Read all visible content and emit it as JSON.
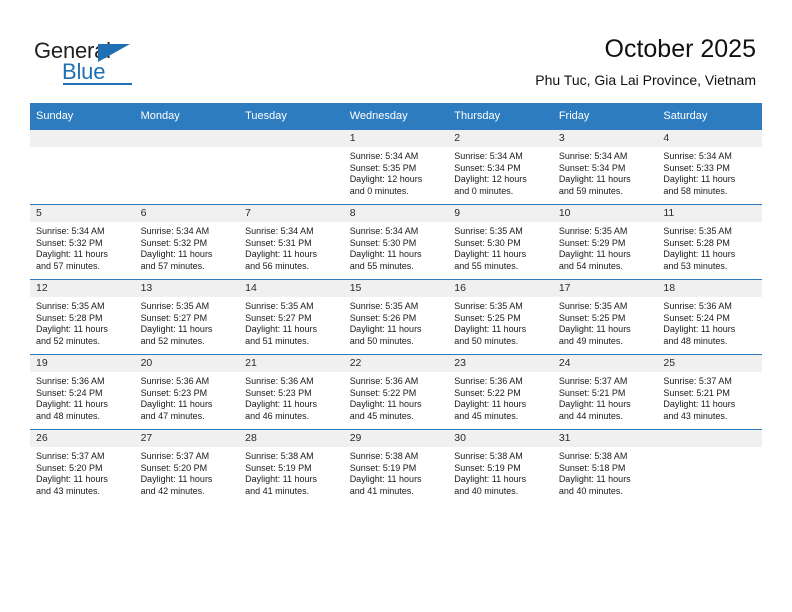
{
  "brand": {
    "name_part1": "General",
    "name_part2": "Blue",
    "accent_color": "#1f6fb4"
  },
  "header": {
    "title": "October 2025",
    "subtitle": "Phu Tuc, Gia Lai Province, Vietnam",
    "header_bg": "#2e7cc0"
  },
  "weekday_headers": [
    "Sunday",
    "Monday",
    "Tuesday",
    "Wednesday",
    "Thursday",
    "Friday",
    "Saturday"
  ],
  "weeks": [
    [
      {
        "day": "",
        "blank": true,
        "l1": "",
        "l2": "",
        "l3": "",
        "l4": ""
      },
      {
        "day": "",
        "blank": true,
        "l1": "",
        "l2": "",
        "l3": "",
        "l4": ""
      },
      {
        "day": "",
        "blank": true,
        "l1": "",
        "l2": "",
        "l3": "",
        "l4": ""
      },
      {
        "day": "1",
        "blank": false,
        "l1": "Sunrise: 5:34 AM",
        "l2": "Sunset: 5:35 PM",
        "l3": "Daylight: 12 hours",
        "l4": "and 0 minutes."
      },
      {
        "day": "2",
        "blank": false,
        "l1": "Sunrise: 5:34 AM",
        "l2": "Sunset: 5:34 PM",
        "l3": "Daylight: 12 hours",
        "l4": "and 0 minutes."
      },
      {
        "day": "3",
        "blank": false,
        "l1": "Sunrise: 5:34 AM",
        "l2": "Sunset: 5:34 PM",
        "l3": "Daylight: 11 hours",
        "l4": "and 59 minutes."
      },
      {
        "day": "4",
        "blank": false,
        "l1": "Sunrise: 5:34 AM",
        "l2": "Sunset: 5:33 PM",
        "l3": "Daylight: 11 hours",
        "l4": "and 58 minutes."
      }
    ],
    [
      {
        "day": "5",
        "blank": false,
        "l1": "Sunrise: 5:34 AM",
        "l2": "Sunset: 5:32 PM",
        "l3": "Daylight: 11 hours",
        "l4": "and 57 minutes."
      },
      {
        "day": "6",
        "blank": false,
        "l1": "Sunrise: 5:34 AM",
        "l2": "Sunset: 5:32 PM",
        "l3": "Daylight: 11 hours",
        "l4": "and 57 minutes."
      },
      {
        "day": "7",
        "blank": false,
        "l1": "Sunrise: 5:34 AM",
        "l2": "Sunset: 5:31 PM",
        "l3": "Daylight: 11 hours",
        "l4": "and 56 minutes."
      },
      {
        "day": "8",
        "blank": false,
        "l1": "Sunrise: 5:34 AM",
        "l2": "Sunset: 5:30 PM",
        "l3": "Daylight: 11 hours",
        "l4": "and 55 minutes."
      },
      {
        "day": "9",
        "blank": false,
        "l1": "Sunrise: 5:35 AM",
        "l2": "Sunset: 5:30 PM",
        "l3": "Daylight: 11 hours",
        "l4": "and 55 minutes."
      },
      {
        "day": "10",
        "blank": false,
        "l1": "Sunrise: 5:35 AM",
        "l2": "Sunset: 5:29 PM",
        "l3": "Daylight: 11 hours",
        "l4": "and 54 minutes."
      },
      {
        "day": "11",
        "blank": false,
        "l1": "Sunrise: 5:35 AM",
        "l2": "Sunset: 5:28 PM",
        "l3": "Daylight: 11 hours",
        "l4": "and 53 minutes."
      }
    ],
    [
      {
        "day": "12",
        "blank": false,
        "l1": "Sunrise: 5:35 AM",
        "l2": "Sunset: 5:28 PM",
        "l3": "Daylight: 11 hours",
        "l4": "and 52 minutes."
      },
      {
        "day": "13",
        "blank": false,
        "l1": "Sunrise: 5:35 AM",
        "l2": "Sunset: 5:27 PM",
        "l3": "Daylight: 11 hours",
        "l4": "and 52 minutes."
      },
      {
        "day": "14",
        "blank": false,
        "l1": "Sunrise: 5:35 AM",
        "l2": "Sunset: 5:27 PM",
        "l3": "Daylight: 11 hours",
        "l4": "and 51 minutes."
      },
      {
        "day": "15",
        "blank": false,
        "l1": "Sunrise: 5:35 AM",
        "l2": "Sunset: 5:26 PM",
        "l3": "Daylight: 11 hours",
        "l4": "and 50 minutes."
      },
      {
        "day": "16",
        "blank": false,
        "l1": "Sunrise: 5:35 AM",
        "l2": "Sunset: 5:25 PM",
        "l3": "Daylight: 11 hours",
        "l4": "and 50 minutes."
      },
      {
        "day": "17",
        "blank": false,
        "l1": "Sunrise: 5:35 AM",
        "l2": "Sunset: 5:25 PM",
        "l3": "Daylight: 11 hours",
        "l4": "and 49 minutes."
      },
      {
        "day": "18",
        "blank": false,
        "l1": "Sunrise: 5:36 AM",
        "l2": "Sunset: 5:24 PM",
        "l3": "Daylight: 11 hours",
        "l4": "and 48 minutes."
      }
    ],
    [
      {
        "day": "19",
        "blank": false,
        "l1": "Sunrise: 5:36 AM",
        "l2": "Sunset: 5:24 PM",
        "l3": "Daylight: 11 hours",
        "l4": "and 48 minutes."
      },
      {
        "day": "20",
        "blank": false,
        "l1": "Sunrise: 5:36 AM",
        "l2": "Sunset: 5:23 PM",
        "l3": "Daylight: 11 hours",
        "l4": "and 47 minutes."
      },
      {
        "day": "21",
        "blank": false,
        "l1": "Sunrise: 5:36 AM",
        "l2": "Sunset: 5:23 PM",
        "l3": "Daylight: 11 hours",
        "l4": "and 46 minutes."
      },
      {
        "day": "22",
        "blank": false,
        "l1": "Sunrise: 5:36 AM",
        "l2": "Sunset: 5:22 PM",
        "l3": "Daylight: 11 hours",
        "l4": "and 45 minutes."
      },
      {
        "day": "23",
        "blank": false,
        "l1": "Sunrise: 5:36 AM",
        "l2": "Sunset: 5:22 PM",
        "l3": "Daylight: 11 hours",
        "l4": "and 45 minutes."
      },
      {
        "day": "24",
        "blank": false,
        "l1": "Sunrise: 5:37 AM",
        "l2": "Sunset: 5:21 PM",
        "l3": "Daylight: 11 hours",
        "l4": "and 44 minutes."
      },
      {
        "day": "25",
        "blank": false,
        "l1": "Sunrise: 5:37 AM",
        "l2": "Sunset: 5:21 PM",
        "l3": "Daylight: 11 hours",
        "l4": "and 43 minutes."
      }
    ],
    [
      {
        "day": "26",
        "blank": false,
        "l1": "Sunrise: 5:37 AM",
        "l2": "Sunset: 5:20 PM",
        "l3": "Daylight: 11 hours",
        "l4": "and 43 minutes."
      },
      {
        "day": "27",
        "blank": false,
        "l1": "Sunrise: 5:37 AM",
        "l2": "Sunset: 5:20 PM",
        "l3": "Daylight: 11 hours",
        "l4": "and 42 minutes."
      },
      {
        "day": "28",
        "blank": false,
        "l1": "Sunrise: 5:38 AM",
        "l2": "Sunset: 5:19 PM",
        "l3": "Daylight: 11 hours",
        "l4": "and 41 minutes."
      },
      {
        "day": "29",
        "blank": false,
        "l1": "Sunrise: 5:38 AM",
        "l2": "Sunset: 5:19 PM",
        "l3": "Daylight: 11 hours",
        "l4": "and 41 minutes."
      },
      {
        "day": "30",
        "blank": false,
        "l1": "Sunrise: 5:38 AM",
        "l2": "Sunset: 5:19 PM",
        "l3": "Daylight: 11 hours",
        "l4": "and 40 minutes."
      },
      {
        "day": "31",
        "blank": false,
        "l1": "Sunrise: 5:38 AM",
        "l2": "Sunset: 5:18 PM",
        "l3": "Daylight: 11 hours",
        "l4": "and 40 minutes."
      },
      {
        "day": "",
        "blank": true,
        "l1": "",
        "l2": "",
        "l3": "",
        "l4": ""
      }
    ]
  ]
}
